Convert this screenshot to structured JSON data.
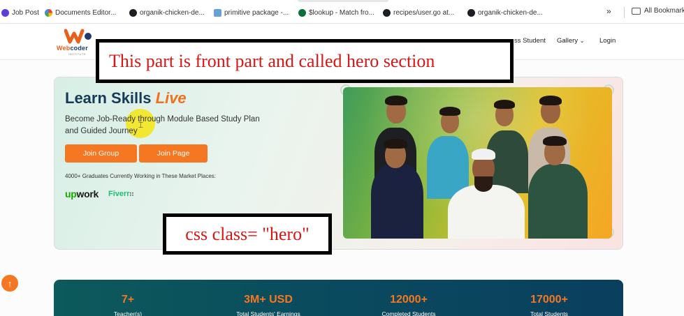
{
  "bookmarks": [
    {
      "label": "Job Post",
      "icon": "v-logo-icon"
    },
    {
      "label": "Documents Editor...",
      "icon": "documents-icon"
    },
    {
      "label": "organik-chicken-de...",
      "icon": "github-icon"
    },
    {
      "label": "primitive package -...",
      "icon": "package-icon"
    },
    {
      "label": "$lookup - Match fro...",
      "icon": "mongodb-leaf-icon"
    },
    {
      "label": "recipes/user.go at...",
      "icon": "github-icon"
    },
    {
      "label": "organik-chicken-de...",
      "icon": "github-icon"
    }
  ],
  "bookmarks_overflow": "»",
  "all_bookmarks": "All Bookmark",
  "logo": {
    "text_a": "Web",
    "text_b": "coder",
    "sub": "INSTITUTE"
  },
  "nav": {
    "item1": "ss Student",
    "item2": "Gallery",
    "item3": "Login"
  },
  "annotations": {
    "top": "This part is front part and called  hero section",
    "bottom": "css class= \"hero\""
  },
  "hero": {
    "title": "Learn Skills",
    "title_accent": "Live",
    "subtitle": "Become Job-Ready through Module Based Study Plan and Guided Journey",
    "btn_group": "Join Group",
    "btn_page": "Join Page",
    "graduates": "4000+ Graduates Currently Working in These Market Places:",
    "upwork_a": "up",
    "upwork_b": "work",
    "fiverr": "Fiverr"
  },
  "stats": [
    {
      "num": "7+",
      "label": "Teacher(s)"
    },
    {
      "num": "3M+ USD",
      "label": "Total Students' Earnings"
    },
    {
      "num": "12000+",
      "label": "Completed Students"
    },
    {
      "num": "17000+",
      "label": "Total Students"
    }
  ],
  "colors": {
    "accent": "#f57722",
    "navy": "#173a56",
    "annotation_red": "#d81616",
    "stats_bg": "#0a4a5e"
  }
}
